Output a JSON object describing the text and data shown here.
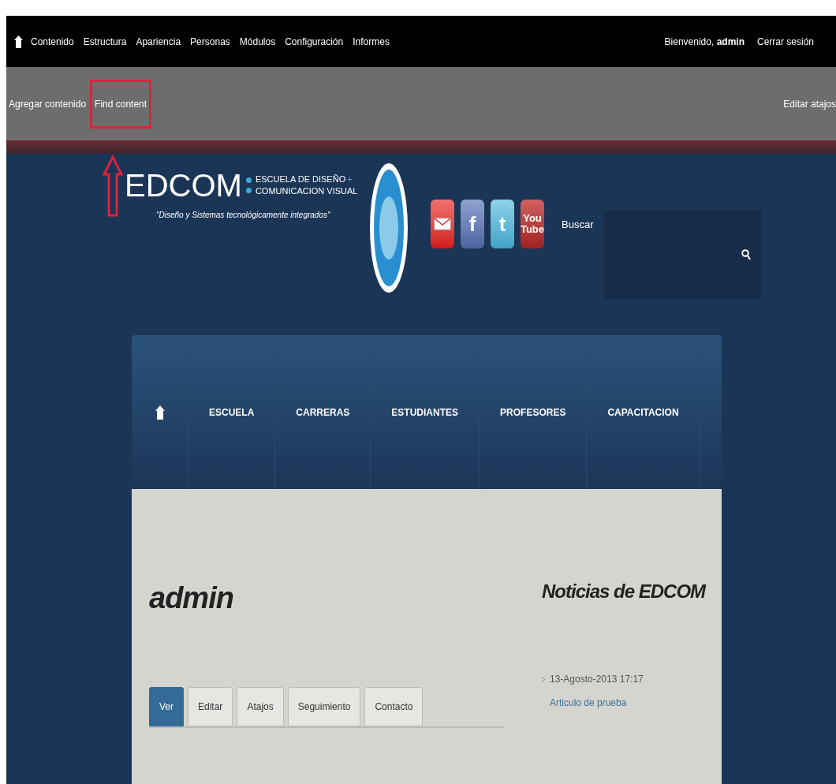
{
  "toolbar": {
    "menu": [
      {
        "label": "Contenido"
      },
      {
        "label": "Estructura"
      },
      {
        "label": "Apariencia"
      },
      {
        "label": "Personas"
      },
      {
        "label": "Módulos"
      },
      {
        "label": "Configuración"
      },
      {
        "label": "Informes"
      }
    ],
    "welcome": "Bienvenido, **admin**",
    "logout": "Cerrar sesión"
  },
  "shortcuts": {
    "items": [
      {
        "label": "Agregar contenido",
        "highlighted": false
      },
      {
        "label": "Find content",
        "highlighted": true
      }
    ],
    "edit": "Editar atajos"
  },
  "header": {
    "logo": {
      "name": "EDCOM",
      "line1": "ESCUELA DE DISEÑO",
      "plus": "+",
      "line2": "COMUNICACION VISUAL",
      "slogan": "\"Diseño y Sistemas tecnológicamente integrados\""
    },
    "social": [
      {
        "kind": "mail"
      },
      {
        "kind": "facebook",
        "label": "f"
      },
      {
        "kind": "twitter",
        "label": "t"
      },
      {
        "kind": "youtube",
        "label": "You Tube"
      }
    ],
    "search": {
      "label": "Buscar"
    }
  },
  "nav": [
    {
      "kind": "home"
    },
    {
      "kind": "link",
      "label": "ESCUELA"
    },
    {
      "kind": "link",
      "label": "CARRERAS"
    },
    {
      "kind": "link",
      "label": "ESTUDIANTES"
    },
    {
      "kind": "link",
      "label": "PROFESORES"
    },
    {
      "kind": "link",
      "label": "CAPACITACION"
    }
  ],
  "content": {
    "title": "admin",
    "tabs": [
      {
        "label": "Ver",
        "selected": true
      },
      {
        "label": "Editar",
        "selected": false
      },
      {
        "label": "Atajos",
        "selected": false
      },
      {
        "label": "Seguimiento",
        "selected": false
      },
      {
        "label": "Contacto",
        "selected": false
      }
    ]
  },
  "sidebar": {
    "title": "Noticias de EDCOM",
    "news": [
      {
        "date": "13-Agosto-2013 17:17",
        "link": "Articulo de prueba"
      }
    ]
  }
}
